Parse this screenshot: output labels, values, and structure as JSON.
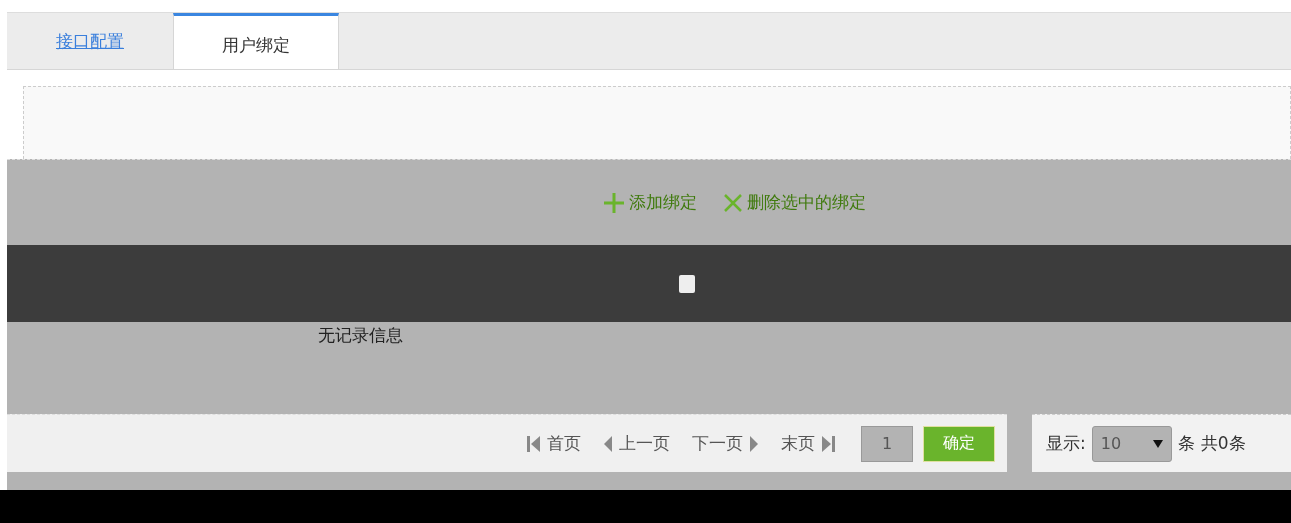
{
  "tabs": [
    {
      "label": "接口配置",
      "selected": false
    },
    {
      "label": "用户绑定",
      "selected": true
    }
  ],
  "toolbar": {
    "add": "添加绑定",
    "delete": "删除选中的绑定"
  },
  "table": {
    "select_all": {
      "checked": false
    },
    "empty_text": "无记录信息"
  },
  "pager": {
    "first": "首页",
    "prev": "上一页",
    "next": "下一页",
    "last": "末页",
    "page": "1",
    "go": "确定",
    "show_label": "显示:",
    "page_size": "10",
    "unit": "条",
    "total": "共0条"
  }
}
